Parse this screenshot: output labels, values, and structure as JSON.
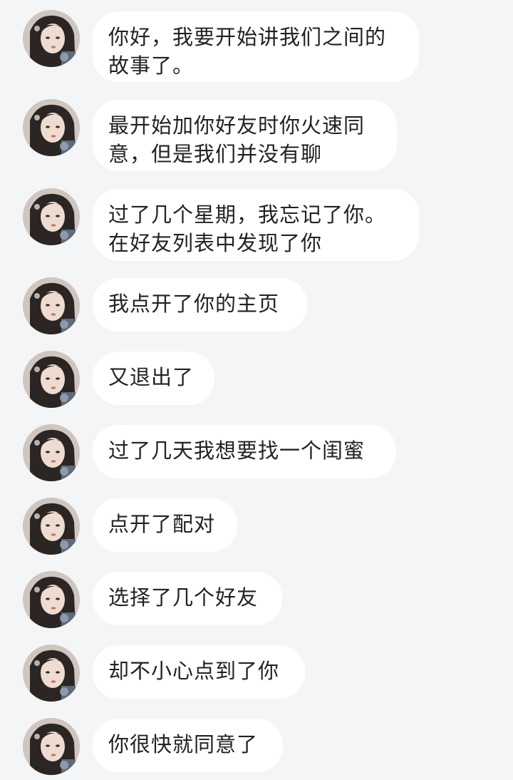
{
  "messages": [
    {
      "lines": [
        "你好，我要开始讲我们之间的",
        "故事了。"
      ]
    },
    {
      "lines": [
        "最开始加你好友时你火速同",
        "意，但是我们并没有聊"
      ]
    },
    {
      "lines": [
        "过了几个星期，我忘记了你。",
        "在好友列表中发现了你"
      ]
    },
    {
      "lines": [
        "我点开了你的主页"
      ]
    },
    {
      "lines": [
        "又退出了"
      ]
    },
    {
      "lines": [
        "过了几天我想要找一个闺蜜"
      ]
    },
    {
      "lines": [
        "点开了配对"
      ]
    },
    {
      "lines": [
        "选择了几个好友"
      ]
    },
    {
      "lines": [
        "却不小心点到了你"
      ]
    },
    {
      "lines": [
        "你很快就同意了"
      ]
    }
  ],
  "avatar_icon": "user-avatar-photo-icon",
  "colors": {
    "background": "#f4f5f7",
    "bubble": "#ffffff",
    "text": "#222222"
  }
}
